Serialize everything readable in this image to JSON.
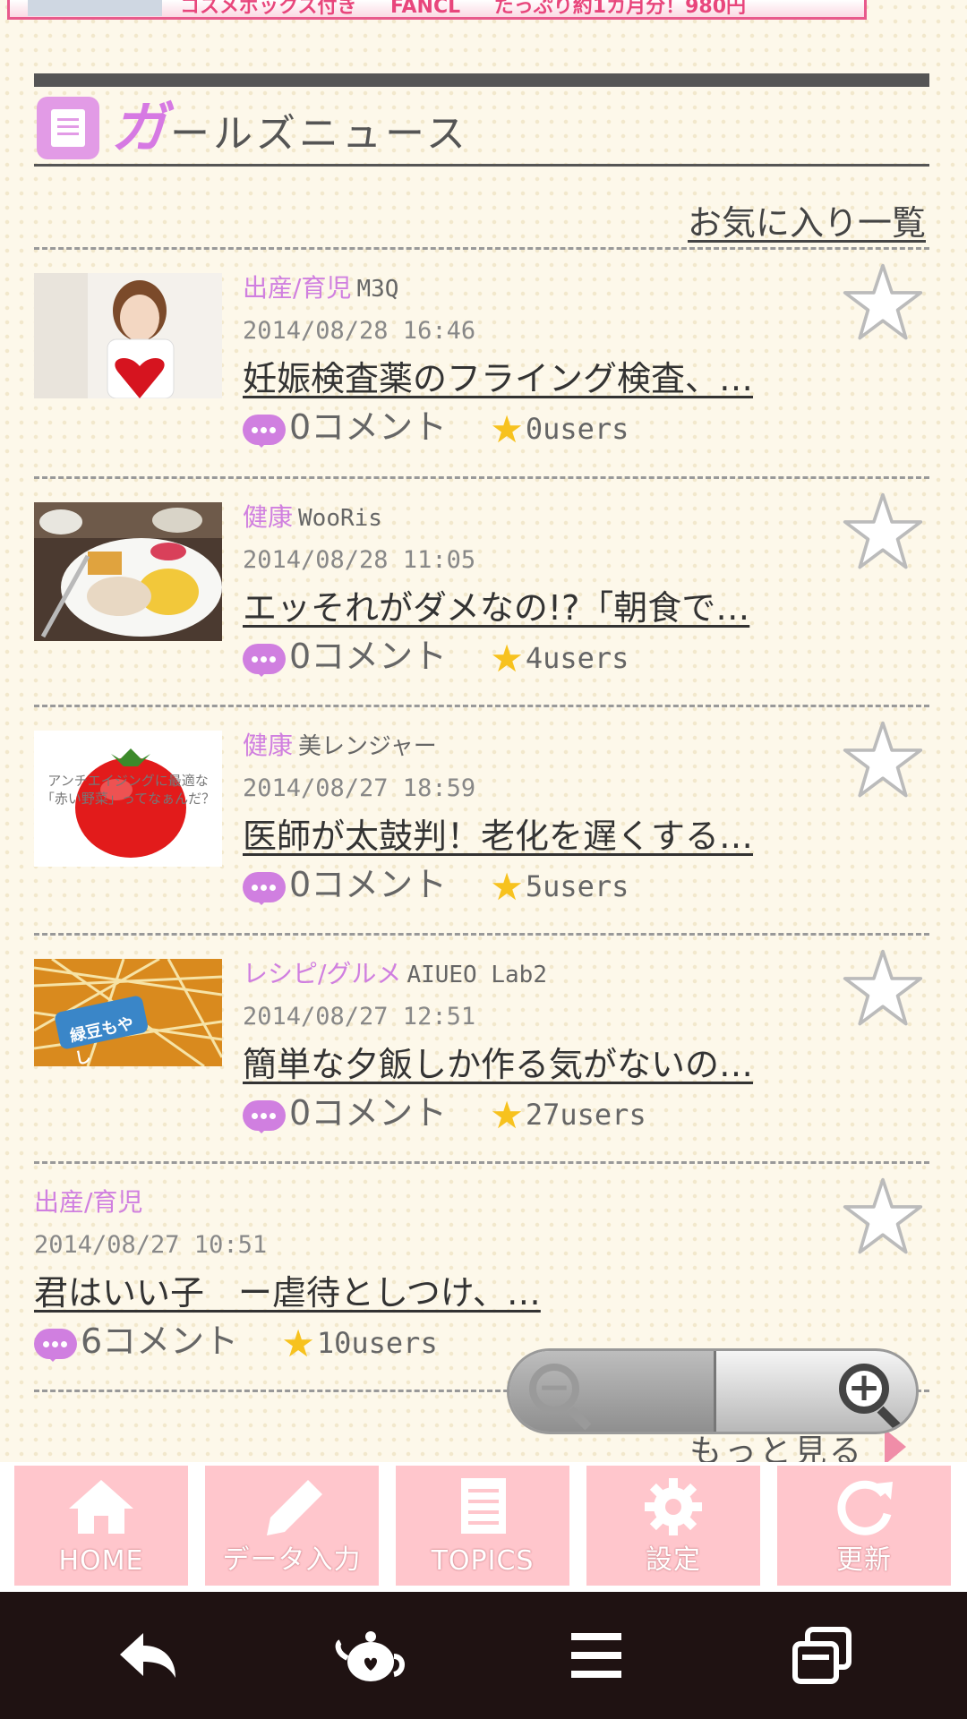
{
  "banner": {
    "texts": [
      "コスメボックス付き",
      "FANCL",
      "たっぷり約1カ月分！980円"
    ]
  },
  "section": {
    "title_first": "ガ",
    "title_rest": "ールズニュース"
  },
  "favorites_link": "お気に入り一覧",
  "articles": [
    {
      "category": "出産/育児",
      "source": "M3Q",
      "date": "2014/08/28 16:46",
      "title": "妊娠検査薬のフライング検査、…",
      "comments": "0コメント",
      "users": "0users",
      "thumb": "girl-with-heart"
    },
    {
      "category": "健康",
      "source": "WooRis",
      "date": "2014/08/28 11:05",
      "title": "エッそれがダメなの!?「朝食で…",
      "comments": "0コメント",
      "users": "4users",
      "thumb": "breakfast-plate"
    },
    {
      "category": "健康",
      "source": "美レンジャー",
      "date": "2014/08/27 18:59",
      "title": "医師が太鼓判！老化を遅くする…",
      "comments": "0コメント",
      "users": "5users",
      "thumb": "tomato",
      "thumb_text": [
        "アンチエイジングに最適な",
        "「赤い野菜」ってなぁんだ？"
      ]
    },
    {
      "category": "レシピ/グルメ",
      "source": "AIUEO Lab2",
      "date": "2014/08/27 12:51",
      "title": "簡単な夕飯しか作る気がないの…",
      "comments": "0コメント",
      "users": "27users",
      "thumb": "bean-sprouts",
      "thumb_text": [
        "緑豆もやし"
      ]
    },
    {
      "category": "出産/育児",
      "source": "",
      "date": "2014/08/27 10:51",
      "title": "君はいい子　ー虐待としつけ、…",
      "comments": "6コメント",
      "users": "10users",
      "thumb": ""
    }
  ],
  "more_label": "もっと見る",
  "tabs": [
    {
      "label": "HOME",
      "icon": "home-icon"
    },
    {
      "label": "データ入力",
      "icon": "pencil-icon"
    },
    {
      "label": "TOPICS",
      "icon": "document-icon"
    },
    {
      "label": "設定",
      "icon": "gear-icon"
    },
    {
      "label": "更新",
      "icon": "refresh-icon"
    }
  ],
  "navbar": [
    "back-icon",
    "teapot-icon",
    "menu-icon",
    "recent-apps-icon"
  ],
  "colors": {
    "accent": "#d07fe0",
    "tab_bg": "#ffc6cc",
    "star": "#f7c21e",
    "page_bg": "#fdf8ea",
    "navbar": "#1f1212"
  }
}
